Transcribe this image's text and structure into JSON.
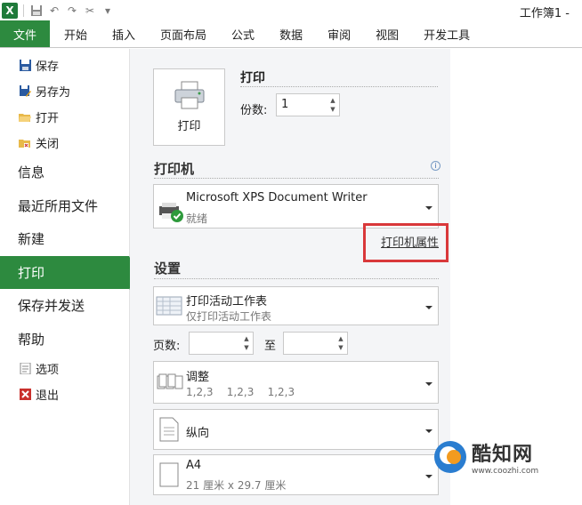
{
  "window": {
    "title": "工作簿1 -"
  },
  "ribbon": {
    "file_tab": "文件",
    "tabs": [
      "开始",
      "插入",
      "页面布局",
      "公式",
      "数据",
      "审阅",
      "视图",
      "开发工具"
    ]
  },
  "nav": {
    "small_top": [
      "保存",
      "另存为",
      "打开",
      "关闭"
    ],
    "big": [
      "信息",
      "最近所用文件",
      "新建",
      "打印",
      "保存并发送",
      "帮助"
    ],
    "small_bottom": [
      "选项",
      "退出"
    ]
  },
  "print": {
    "button_label": "打印",
    "heading": "打印",
    "copies_label": "份数:",
    "copies_value": "1"
  },
  "printer": {
    "section_title": "打印机",
    "name": "Microsoft XPS Document Writer",
    "status": "就绪",
    "properties_link": "打印机属性"
  },
  "settings": {
    "section_title": "设置",
    "scope_main": "打印活动工作表",
    "scope_sub": "仅打印活动工作表",
    "pages_label": "页数:",
    "to_label": "至",
    "collate_main": "调整",
    "collate_sub": "1,2,3    1,2,3    1,2,3",
    "orientation": "纵向",
    "paper_main": "A4",
    "paper_sub": "21 厘米 x 29.7 厘米"
  },
  "watermark": {
    "title": "酷知网",
    "url": "www.coozhi.com"
  },
  "colors": {
    "accent": "#2d8a3f",
    "highlight": "#d9383a"
  }
}
